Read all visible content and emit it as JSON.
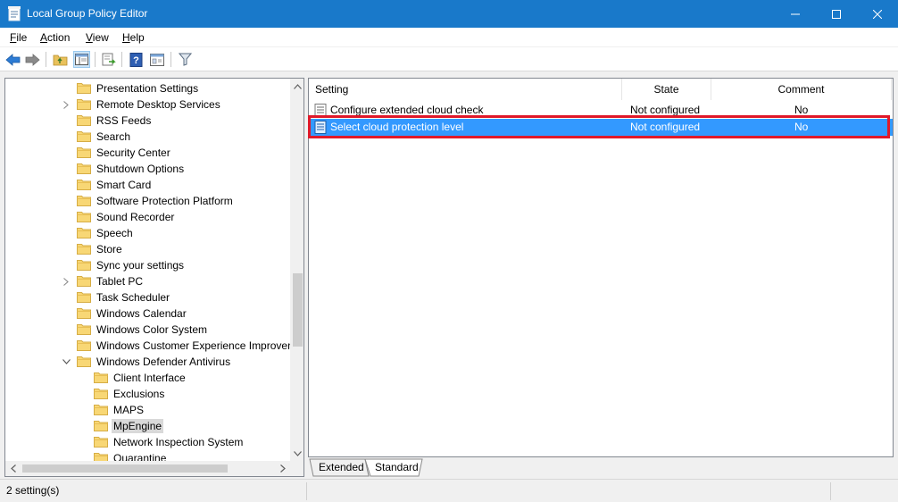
{
  "window": {
    "title": "Local Group Policy Editor",
    "accent_color": "#1979ca",
    "controls": [
      "minimize-icon",
      "maximize-icon",
      "close-icon"
    ]
  },
  "menu": {
    "items": [
      {
        "label": "File",
        "accel": "F",
        "rest": "ile"
      },
      {
        "label": "Action",
        "accel": "A",
        "rest": "ction"
      },
      {
        "label": "View",
        "accel": "V",
        "rest": "iew"
      },
      {
        "label": "Help",
        "accel": "H",
        "rest": "elp"
      }
    ]
  },
  "toolbar": {
    "buttons": [
      "back-icon",
      "forward-icon",
      "up-folder-icon",
      "show-hide-tree-icon",
      "export-list-icon",
      "help-icon",
      "properties-icon",
      "filter-icon"
    ]
  },
  "tree": {
    "items": [
      {
        "label": "Presentation Settings",
        "level": 1,
        "expander": "none",
        "selected": false
      },
      {
        "label": "Remote Desktop Services",
        "level": 1,
        "expander": "collapsed",
        "selected": false
      },
      {
        "label": "RSS Feeds",
        "level": 1,
        "expander": "none",
        "selected": false
      },
      {
        "label": "Search",
        "level": 1,
        "expander": "none",
        "selected": false
      },
      {
        "label": "Security Center",
        "level": 1,
        "expander": "none",
        "selected": false
      },
      {
        "label": "Shutdown Options",
        "level": 1,
        "expander": "none",
        "selected": false
      },
      {
        "label": "Smart Card",
        "level": 1,
        "expander": "none",
        "selected": false
      },
      {
        "label": "Software Protection Platform",
        "level": 1,
        "expander": "none",
        "selected": false
      },
      {
        "label": "Sound Recorder",
        "level": 1,
        "expander": "none",
        "selected": false
      },
      {
        "label": "Speech",
        "level": 1,
        "expander": "none",
        "selected": false
      },
      {
        "label": "Store",
        "level": 1,
        "expander": "none",
        "selected": false
      },
      {
        "label": "Sync your settings",
        "level": 1,
        "expander": "none",
        "selected": false
      },
      {
        "label": "Tablet PC",
        "level": 1,
        "expander": "collapsed",
        "selected": false
      },
      {
        "label": "Task Scheduler",
        "level": 1,
        "expander": "none",
        "selected": false
      },
      {
        "label": "Windows Calendar",
        "level": 1,
        "expander": "none",
        "selected": false
      },
      {
        "label": "Windows Color System",
        "level": 1,
        "expander": "none",
        "selected": false
      },
      {
        "label": "Windows Customer Experience Improven",
        "level": 1,
        "expander": "none",
        "selected": false
      },
      {
        "label": "Windows Defender Antivirus",
        "level": 1,
        "expander": "expanded",
        "selected": false
      },
      {
        "label": "Client Interface",
        "level": 2,
        "expander": "none",
        "selected": false
      },
      {
        "label": "Exclusions",
        "level": 2,
        "expander": "none",
        "selected": false
      },
      {
        "label": "MAPS",
        "level": 2,
        "expander": "none",
        "selected": false
      },
      {
        "label": "MpEngine",
        "level": 2,
        "expander": "none",
        "selected": true
      },
      {
        "label": "Network Inspection System",
        "level": 2,
        "expander": "none",
        "selected": false
      },
      {
        "label": "Quarantine",
        "level": 2,
        "expander": "none",
        "selected": false
      }
    ]
  },
  "list": {
    "columns": [
      {
        "label": "Setting"
      },
      {
        "label": "State"
      },
      {
        "label": "Comment"
      }
    ],
    "rows": [
      {
        "setting": "Configure extended cloud check",
        "state": "Not configured",
        "comment": "No",
        "selected": false
      },
      {
        "setting": "Select cloud protection level",
        "state": "Not configured",
        "comment": "No",
        "selected": true
      }
    ],
    "selection_color": "#3399ff",
    "highlight_color": "#e0192a"
  },
  "tabs": [
    {
      "label": "Extended",
      "active": false
    },
    {
      "label": "Standard",
      "active": true
    }
  ],
  "status": {
    "text": "2 setting(s)"
  }
}
